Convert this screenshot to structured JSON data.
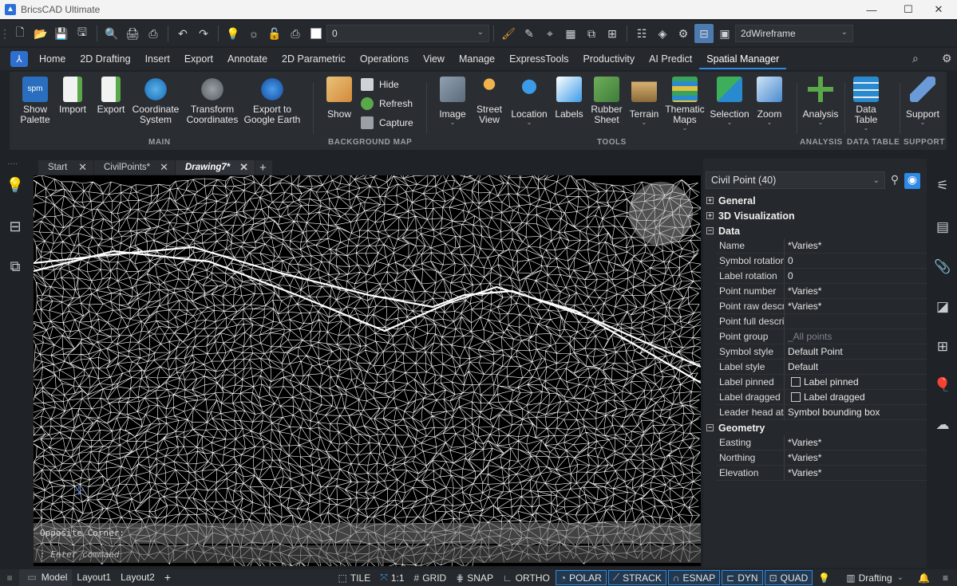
{
  "window": {
    "title": "BricsCAD Ultimate"
  },
  "qat": {
    "layer_value": "0",
    "visual_style": "2dWireframe"
  },
  "ribbon_tabs": [
    "Home",
    "2D Drafting",
    "Insert",
    "Export",
    "Annotate",
    "2D Parametric",
    "Operations",
    "View",
    "Manage",
    "ExpressTools",
    "Productivity",
    "AI Predict",
    "Spatial Manager"
  ],
  "ribbon": {
    "main": {
      "show_palette": "Show\nPalette",
      "import": "Import",
      "export": "Export",
      "coordinate_system": "Coordinate\nSystem",
      "transform_coordinates": "Transform\nCoordinates",
      "export_google_earth": "Export to\nGoogle Earth",
      "group_label": "MAIN"
    },
    "background_map": {
      "show": "Show",
      "hide": "Hide",
      "refresh": "Refresh",
      "capture": "Capture",
      "group_label": "BACKGROUND MAP"
    },
    "tools": {
      "image": "Image",
      "street_view": "Street\nView",
      "location": "Location",
      "labels": "Labels",
      "rubber_sheet": "Rubber\nSheet",
      "terrain": "Terrain",
      "thematic_maps": "Thematic\nMaps",
      "selection": "Selection",
      "zoom": "Zoom",
      "group_label": "TOOLS"
    },
    "analysis": {
      "analysis": "Analysis",
      "group_label": "ANALYSIS"
    },
    "data_table": {
      "data_table": "Data\nTable",
      "group_label": "DATA TABLE"
    },
    "support": {
      "support": "Support",
      "group_label": "SUPPORT"
    }
  },
  "doc_tabs": [
    {
      "label": "Start"
    },
    {
      "label": "CivilPoints*"
    },
    {
      "label": "Drawing7*"
    }
  ],
  "command_line": {
    "history": "Opposite Corner:",
    "prompt": ": Enter command"
  },
  "properties": {
    "selection": "Civil Point (40)",
    "sections": {
      "general": "General",
      "visualization": "3D Visualization",
      "data": "Data",
      "geometry": "Geometry"
    },
    "data_rows": [
      {
        "key": "Name",
        "value": "*Varies*"
      },
      {
        "key": "Symbol rotation",
        "value": "0"
      },
      {
        "key": "Label rotation",
        "value": "0"
      },
      {
        "key": "Point number",
        "value": "*Varies*"
      },
      {
        "key": "Point raw description",
        "value": "*Varies*"
      },
      {
        "key": "Point full description",
        "value": ""
      },
      {
        "key": "Point group",
        "value": "_All points"
      },
      {
        "key": "Symbol style",
        "value": "Default Point"
      },
      {
        "key": "Label style",
        "value": "Default"
      },
      {
        "key": "Label pinned",
        "value": "Label pinned"
      },
      {
        "key": "Label dragged",
        "value": "Label dragged"
      },
      {
        "key": "Leader head at",
        "value": "Symbol bounding box"
      }
    ],
    "geometry_rows": [
      {
        "key": "Easting",
        "value": "*Varies*"
      },
      {
        "key": "Northing",
        "value": "*Varies*"
      },
      {
        "key": "Elevation",
        "value": "*Varies*"
      }
    ]
  },
  "status": {
    "layout_tabs": [
      "Model",
      "Layout1",
      "Layout2"
    ],
    "toggles": {
      "tile": "TILE",
      "scale": "1:1",
      "grid": "GRID",
      "snap": "SNAP",
      "ortho": "ORTHO",
      "polar": "POLAR",
      "strack": "STRACK",
      "esnap": "ESNAP",
      "dyn": "DYN",
      "quad": "QUAD"
    },
    "workspace": "Drafting"
  },
  "colors": {
    "accent": "#2d8ae6",
    "bg": "#1f2226",
    "panel": "#25282c"
  }
}
